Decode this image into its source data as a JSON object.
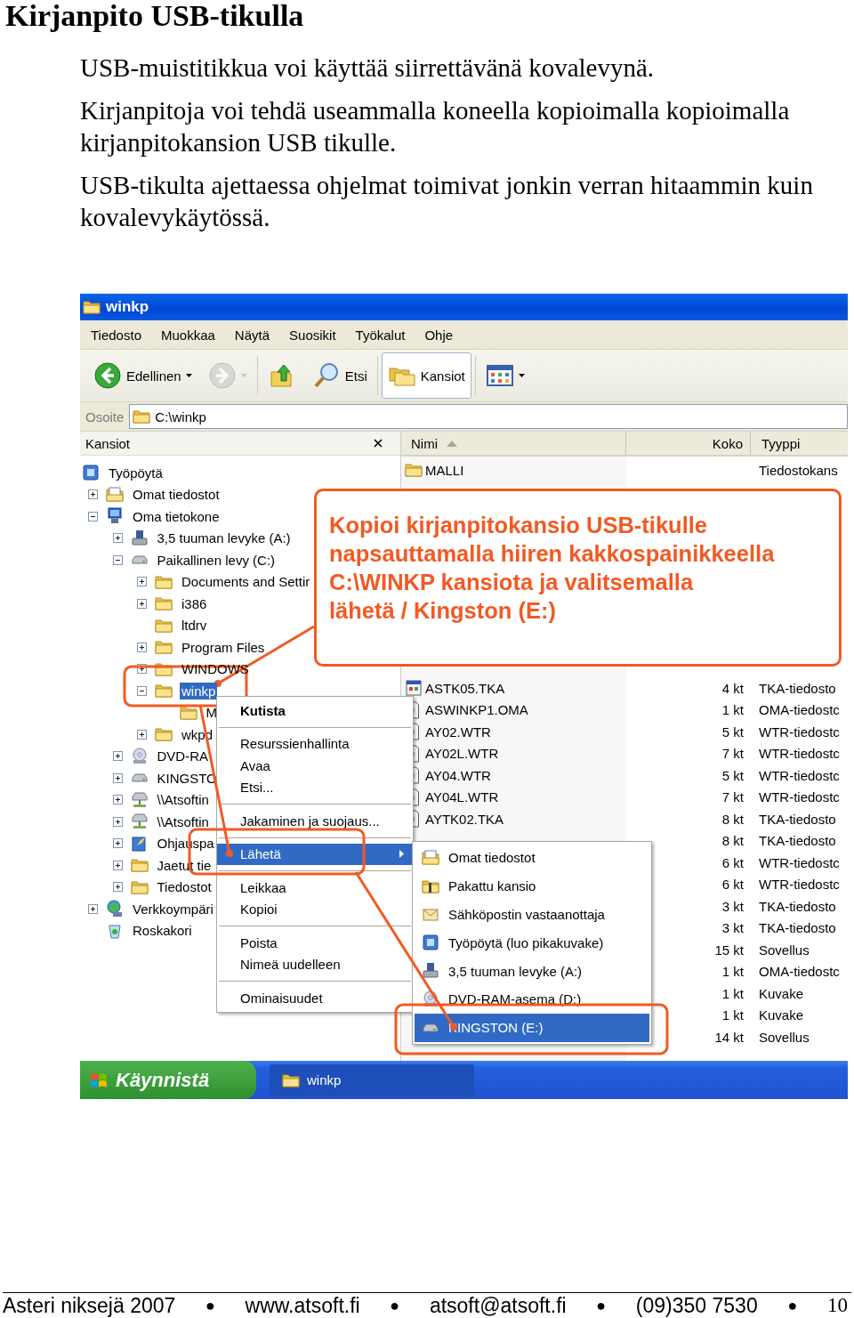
{
  "page": {
    "title": "Kirjanpito USB-tikulla",
    "paragraphs": [
      "USB-muistitikkua voi käyttää siirrettävänä kovalevynä.",
      "Kirjanpitoja voi tehdä useammalla koneella kopioimalla kopioimalla kirjanpitokansion USB tikulle.",
      "USB-tikulta ajettaessa ohjelmat toimivat jonkin verran hitaammin kuin kovalevykäytössä."
    ]
  },
  "window": {
    "title": "winkp",
    "menu": [
      "Tiedosto",
      "Muokkaa",
      "Näytä",
      "Suosikit",
      "Työkalut",
      "Ohje"
    ],
    "toolbar": [
      {
        "kind": "back",
        "label": "Edellinen",
        "dropdown": true,
        "disabled": false,
        "selected": false
      },
      {
        "kind": "forward",
        "dropdown": true,
        "disabled": true,
        "selected": false
      },
      {
        "kind": "up",
        "dropdown": false,
        "disabled": false,
        "selected": false
      },
      {
        "kind": "search",
        "label": "Etsi",
        "dropdown": false,
        "disabled": false,
        "selected": false
      },
      {
        "kind": "folders",
        "label": "Kansiot",
        "dropdown": false,
        "disabled": false,
        "selected": true
      },
      {
        "kind": "views",
        "dropdown": true,
        "disabled": false,
        "selected": false
      }
    ],
    "address": {
      "label": "Osoite",
      "value": "C:\\winkp"
    },
    "folders_pane": {
      "title": "Kansiot",
      "tree": [
        {
          "label": "Työpöytä",
          "kind": "desktop",
          "selected": false,
          "children": [
            {
              "label": "Omat tiedostot",
              "kind": "docs",
              "expanded": false,
              "selected": false
            },
            {
              "label": "Oma tietokone",
              "kind": "computer",
              "expanded": true,
              "selected": false,
              "children": [
                {
                  "label": "3,5 tuuman levyke (A:)",
                  "kind": "floppy",
                  "expanded": false,
                  "selected": false
                },
                {
                  "label": "Paikallinen levy (C:)",
                  "kind": "drive",
                  "expanded": true,
                  "selected": false,
                  "children": [
                    {
                      "label": "Documents and Settir",
                      "kind": "folder",
                      "expanded": false,
                      "selected": false
                    },
                    {
                      "label": "i386",
                      "kind": "folder",
                      "expanded": false,
                      "selected": false
                    },
                    {
                      "label": "ltdrv",
                      "kind": "folder",
                      "selected": false
                    },
                    {
                      "label": "Program Files",
                      "kind": "folder",
                      "expanded": false,
                      "selected": false
                    },
                    {
                      "label": "WINDOWS",
                      "kind": "folder",
                      "expanded": false,
                      "selected": false
                    },
                    {
                      "label": "winkp",
                      "kind": "folder",
                      "expanded": true,
                      "selected": true,
                      "children": [
                        {
                          "label": "M",
                          "kind": "folder",
                          "selected": false
                        }
                      ]
                    },
                    {
                      "label": "wkpd",
                      "kind": "folder",
                      "expanded": false,
                      "selected": false
                    }
                  ]
                },
                {
                  "label": "DVD-RA",
                  "kind": "disc",
                  "expanded": false,
                  "selected": false
                },
                {
                  "label": "KINGSTO",
                  "kind": "drive",
                  "expanded": false,
                  "selected": false
                },
                {
                  "label": "\\\\Atsoftin",
                  "kind": "netdrive",
                  "expanded": false,
                  "selected": false
                },
                {
                  "label": "\\\\Atsoftin",
                  "kind": "netdrive",
                  "expanded": false,
                  "selected": false
                },
                {
                  "label": "Ohjauspa",
                  "kind": "control",
                  "expanded": false,
                  "selected": false
                },
                {
                  "label": "Jaetut tie",
                  "kind": "folder",
                  "expanded": false,
                  "selected": false
                },
                {
                  "label": "Tiedostot",
                  "kind": "folder",
                  "expanded": false,
                  "selected": false
                }
              ]
            },
            {
              "label": "Verkkoympäri",
              "kind": "network",
              "expanded": false,
              "selected": false
            },
            {
              "label": "Roskakori",
              "kind": "trash",
              "selected": false
            }
          ]
        }
      ]
    },
    "file_list": {
      "columns": [
        {
          "label": "Nimi",
          "sorted": true
        },
        {
          "label": "Koko",
          "sorted": false
        },
        {
          "label": "Tyyppi",
          "sorted": false
        }
      ],
      "rows": [
        {
          "kind": "folder",
          "name": "MALLI",
          "type": "Tiedostokans"
        },
        {
          "kind": "app",
          "name": "ASTK05.TKA",
          "size": "4 kt",
          "type": "TKA-tiedosto"
        },
        {
          "kind": "file",
          "name": "ASWINKP1.OMA",
          "size": "1 kt",
          "type": "OMA-tiedostc"
        },
        {
          "kind": "file",
          "name": "AY02.WTR",
          "size": "5 kt",
          "type": "WTR-tiedostc"
        },
        {
          "kind": "file",
          "name": "AY02L.WTR",
          "size": "7 kt",
          "type": "WTR-tiedostc"
        },
        {
          "kind": "file",
          "name": "AY04.WTR",
          "size": "5 kt",
          "type": "WTR-tiedostc"
        },
        {
          "kind": "file",
          "name": "AY04L.WTR",
          "size": "7 kt",
          "type": "WTR-tiedostc"
        },
        {
          "kind": "file",
          "name": "AYTK02.TKA",
          "size": "8 kt",
          "type": "TKA-tiedosto"
        },
        {
          "size": "8 kt",
          "type": "TKA-tiedosto"
        },
        {
          "size": "6 kt",
          "type": "WTR-tiedostc"
        },
        {
          "size": "6 kt",
          "type": "WTR-tiedostc"
        },
        {
          "size": "3 kt",
          "type": "TKA-tiedosto"
        },
        {
          "size": "3 kt",
          "type": "TKA-tiedosto"
        },
        {
          "size": "15 kt",
          "type": "Sovellus"
        },
        {
          "size": "1 kt",
          "type": "OMA-tiedostc"
        },
        {
          "size": "1 kt",
          "type": "Kuvake"
        },
        {
          "size": "1 kt",
          "type": "Kuvake"
        },
        {
          "size": "14 kt",
          "type": "Sovellus"
        }
      ]
    },
    "context_menu": {
      "groups": [
        [
          {
            "label": "Kutista",
            "default": true,
            "submenu": false,
            "selected": false
          }
        ],
        [
          {
            "label": "Resurssienhallinta",
            "default": false,
            "submenu": false,
            "selected": false
          },
          {
            "label": "Avaa",
            "default": false,
            "submenu": false,
            "selected": false
          },
          {
            "label": "Etsi...",
            "default": false,
            "submenu": false,
            "selected": false
          }
        ],
        [
          {
            "label": "Jakaminen ja suojaus...",
            "default": false,
            "submenu": false,
            "selected": false
          }
        ],
        [
          {
            "label": "Lähetä",
            "default": false,
            "submenu": true,
            "selected": true
          }
        ],
        [
          {
            "label": "Leikkaa",
            "default": false,
            "submenu": false,
            "selected": false
          },
          {
            "label": "Kopioi",
            "default": false,
            "submenu": false,
            "selected": false
          }
        ],
        [
          {
            "label": "Poista",
            "default": false,
            "submenu": false,
            "selected": false
          },
          {
            "label": "Nimeä uudelleen",
            "default": false,
            "submenu": false,
            "selected": false
          }
        ],
        [
          {
            "label": "Ominaisuudet",
            "default": false,
            "submenu": false,
            "selected": false
          }
        ]
      ]
    },
    "send_to_menu": {
      "items": [
        {
          "kind": "docs",
          "label": "Omat tiedostot",
          "selected": false
        },
        {
          "kind": "zip",
          "label": "Pakattu kansio",
          "selected": false
        },
        {
          "kind": "mail",
          "label": "Sähköpostin vastaanottaja",
          "selected": false
        },
        {
          "kind": "desktop",
          "label": "Työpöytä (luo pikakuvake)",
          "selected": false
        },
        {
          "kind": "floppy",
          "label": "3,5 tuuman levyke (A:)",
          "selected": false
        },
        {
          "kind": "disc",
          "label": "DVD-RAM-asema (D:)",
          "selected": false
        },
        {
          "kind": "drive",
          "label": "KINGSTON (E:)",
          "selected": true
        }
      ]
    },
    "callout": {
      "lines": [
        "Kopioi kirjanpitokansio USB-tikulle",
        "napsauttamalla hiiren kakkospainikkeella",
        "C:\\WINKP kansiota ja valitsemalla",
        "lähetä / Kingston (E:)"
      ]
    },
    "taskbar": {
      "start": "Käynnistä",
      "tasks": [
        {
          "label": "winkp",
          "selected": true
        }
      ]
    }
  },
  "footer": [
    {
      "kind": "text",
      "text": "Asteri niksejä 2007"
    },
    {
      "kind": "bullet",
      "text": "●"
    },
    {
      "kind": "text",
      "text": "www.atsoft.fi"
    },
    {
      "kind": "bullet",
      "text": "●"
    },
    {
      "kind": "text",
      "text": "atsoft@atsoft.fi"
    },
    {
      "kind": "bullet",
      "text": "●"
    },
    {
      "kind": "text",
      "text": "(09)350 7530"
    },
    {
      "kind": "bullet",
      "text": "●"
    },
    {
      "kind": "page",
      "text": "10"
    }
  ]
}
